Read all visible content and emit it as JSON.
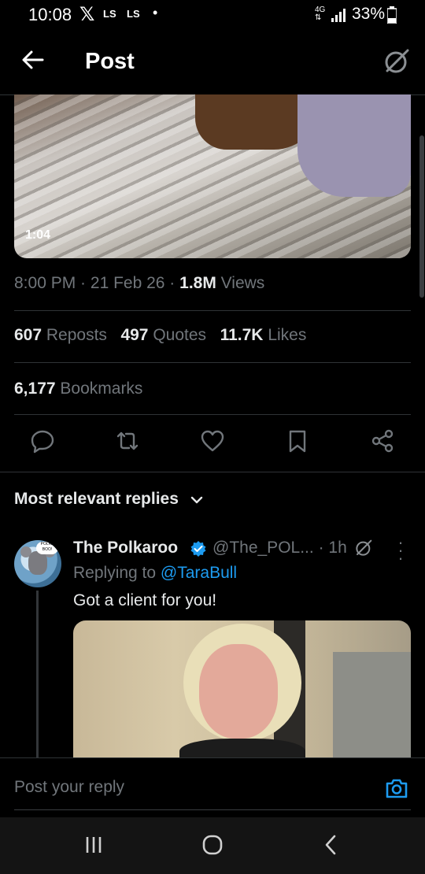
{
  "status_bar": {
    "time": "10:08",
    "x_glyph": "𝕏",
    "ls1": "LS",
    "ls2": "LS",
    "dot": "•",
    "network_top": "4G",
    "network_bottom": "⇅",
    "battery": "33%"
  },
  "header": {
    "title": "Post"
  },
  "media": {
    "duration": "1:04"
  },
  "post_meta": {
    "time": "8:00 PM",
    "date": "21 Feb 26",
    "views_count": "1.8M",
    "views_label": "Views"
  },
  "stats": {
    "reposts_count": "607",
    "reposts_label": "Reposts",
    "quotes_count": "497",
    "quotes_label": "Quotes",
    "likes_count": "11.7K",
    "likes_label": "Likes",
    "bookmarks_count": "6,177",
    "bookmarks_label": "Bookmarks"
  },
  "actions": [
    "reply-icon",
    "repost-icon",
    "like-icon",
    "bookmark-icon",
    "share-icon"
  ],
  "replies_filter": {
    "label": "Most relevant replies"
  },
  "reply": {
    "name": "The Polkaroo",
    "handle": "@The_POL...",
    "time": "· 1h",
    "replying_prefix": "Replying to",
    "replying_to": "@TaraBull",
    "text": "Got a client for you!",
    "avatar_bubble": "POLKA BOO!"
  },
  "composer": {
    "placeholder": "Post your reply"
  },
  "colors": {
    "accent": "#1d9bf0",
    "background": "#000000",
    "muted": "#71767b",
    "text": "#e7e9ea"
  }
}
